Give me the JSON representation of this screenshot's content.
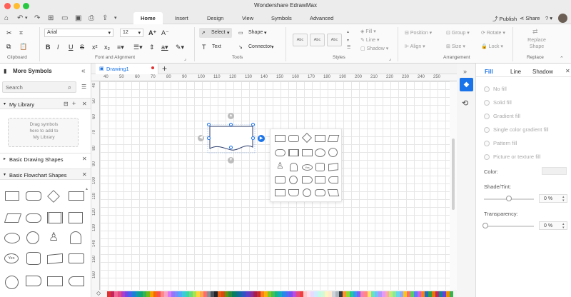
{
  "app": {
    "title": "Wondershare EdrawMax"
  },
  "menu": {
    "tabs": [
      "Home",
      "Insert",
      "Design",
      "View",
      "Symbols",
      "Advanced"
    ],
    "active": "Home",
    "publish": "Publish",
    "share": "Share",
    "help": "?"
  },
  "ribbon": {
    "groups": {
      "clipboard": "Clipboard",
      "font": "Font and Alignment",
      "tools": "Tools",
      "styles": "Styles",
      "arrangement": "Arrangement",
      "replace": "Replace"
    },
    "font_family": "Arial",
    "font_size": "12",
    "select": "Select",
    "shape": "Shape",
    "text": "Text",
    "connector": "Connector",
    "style_labels": [
      "Abc",
      "Abc",
      "Abc"
    ],
    "fill": "Fill",
    "line": "Line",
    "shadow": "Shadow",
    "position": "Position",
    "group": "Group",
    "rotate": "Rotate",
    "align": "Align",
    "size": "Size",
    "lock": "Lock",
    "replace_shape": "Replace\nShape"
  },
  "left": {
    "title": "More Symbols",
    "search_placeholder": "Search",
    "my_library": "My Library",
    "drag_hint": "Drag symbols\nhere to add to\nMy Library",
    "basic_drawing": "Basic Drawing Shapes",
    "basic_flowchart": "Basic Flowchart Shapes",
    "yes_label": "Yes"
  },
  "doc": {
    "tab": "Drawing1"
  },
  "ruler": {
    "h": [
      "40",
      "50",
      "60",
      "70",
      "80",
      "90",
      "100",
      "110",
      "120",
      "130",
      "140",
      "150",
      "160",
      "170",
      "180",
      "190",
      "200",
      "210",
      "220",
      "230",
      "240",
      "250"
    ],
    "v": [
      "40",
      "50",
      "60",
      "70",
      "80",
      "90",
      "100",
      "110",
      "120",
      "130",
      "140",
      "150",
      "160"
    ]
  },
  "right": {
    "tabs": [
      "Fill",
      "Line",
      "Shadow"
    ],
    "active": "Fill",
    "options": [
      "No fill",
      "Solid fill",
      "Gradient fill",
      "Single color gradient fill",
      "Pattern fill",
      "Picture or texture fill"
    ],
    "color": "Color:",
    "shade": "Shade/Tint:",
    "shade_value": "0 %",
    "transparency": "Transparency:",
    "transparency_value": "0 %"
  },
  "colors": {
    "accent": "#1a73e8",
    "palette": [
      "#e03131",
      "#c2255c",
      "#f06595",
      "#e64980",
      "#ae3ec9",
      "#7048e8",
      "#4263eb",
      "#1c7ed6",
      "#1098ad",
      "#0ca678",
      "#37b24d",
      "#74b816",
      "#f59f00",
      "#f76707",
      "#fa5252",
      "#ff8787",
      "#faa2c1",
      "#da77f2",
      "#9775fa",
      "#748ffc",
      "#4dabf7",
      "#3bc9db",
      "#38d9a9",
      "#69db7c",
      "#a9e34b",
      "#ffd43b",
      "#ffa94d",
      "#ff6b6b",
      "#868e96",
      "#495057",
      "#212529",
      "#e8590c",
      "#d9480f",
      "#5c940d",
      "#2b8a3e",
      "#087f5b",
      "#0b7285",
      "#1864ab",
      "#364fc7",
      "#5f3dc4",
      "#862e9c",
      "#a61e4d",
      "#c92a2a",
      "#fd7e14",
      "#fab005",
      "#82c91e",
      "#40c057",
      "#12b886",
      "#15aabf",
      "#228be6",
      "#4c6ef5",
      "#7950f2",
      "#be4bdb",
      "#e64980",
      "#f03e3e",
      "#ffc9c9",
      "#ffdeeb",
      "#e5dbff",
      "#d0ebff",
      "#c3fae8",
      "#d3f9d8",
      "#fff3bf",
      "#ffe8cc",
      "#ced4da",
      "#adb5bd",
      "#343a40",
      "#ff922b",
      "#94d82d",
      "#20c997",
      "#339af0",
      "#845ef7",
      "#f783ac",
      "#ff8787",
      "#ffe066",
      "#63e6be",
      "#74c0fc",
      "#b197fc",
      "#e599f7",
      "#ffa8a8",
      "#c0eb75",
      "#8ce99a",
      "#66d9e8",
      "#91a7ff",
      "#fcc419",
      "#ff6b6b",
      "#51cf66",
      "#5c7cfa",
      "#cc5de8",
      "#fd7e14",
      "#1971c2",
      "#2f9e44",
      "#e67700",
      "#c2255c",
      "#0c8599",
      "#6741d9",
      "#f08c00",
      "#37b24d",
      "#d6336c",
      "#1c7ed6",
      "#fab005"
    ]
  }
}
